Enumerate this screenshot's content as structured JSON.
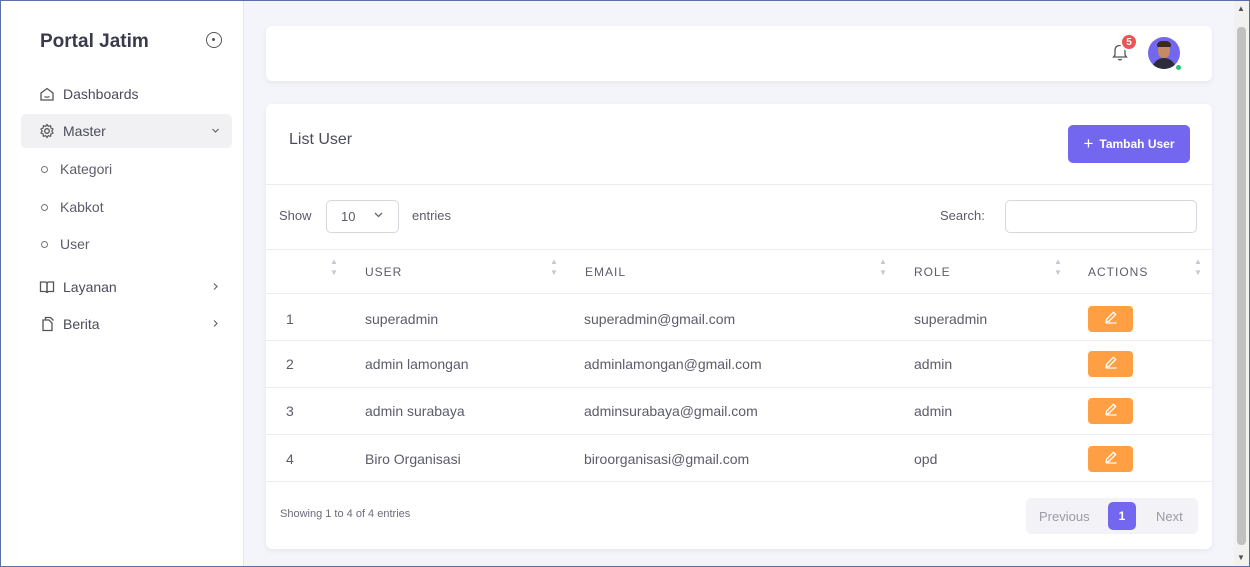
{
  "sidebar": {
    "brand": "Portal Jatim",
    "items": [
      {
        "label": "Dashboards",
        "icon": "home-icon"
      },
      {
        "label": "Master",
        "icon": "gear-icon",
        "chevron": "v"
      },
      {
        "label": "Layanan",
        "icon": "book-icon",
        "chevron": ">"
      },
      {
        "label": "Berita",
        "icon": "copy-icon",
        "chevron": ">"
      }
    ],
    "sub_items": [
      "Kategori",
      "Kabkot",
      "User"
    ]
  },
  "header": {
    "notification_count": "5",
    "avatar_status_color": "#28c76f"
  },
  "card": {
    "title": "List User",
    "add_button": "Tambah User",
    "show_label": "Show",
    "page_length": "10",
    "entries_label": "entries",
    "search_label": "Search:",
    "search_value": ""
  },
  "table": {
    "columns": [
      "USER",
      "EMAIL",
      "ROLE",
      "ACTIONS"
    ],
    "rows": [
      {
        "no": "1",
        "user": "superadmin",
        "email": "superadmin@gmail.com",
        "role": "superadmin"
      },
      {
        "no": "2",
        "user": "admin lamongan",
        "email": "adminlamongan@gmail.com",
        "role": "admin"
      },
      {
        "no": "3",
        "user": "admin surabaya",
        "email": "adminsurabaya@gmail.com",
        "role": "admin"
      },
      {
        "no": "4",
        "user": "Biro Organisasi",
        "email": "biroorganisasi@gmail.com",
        "role": "opd"
      }
    ]
  },
  "footer": {
    "info": "Showing 1 to 4 of 4 entries",
    "previous": "Previous",
    "current_page": "1",
    "next": "Next"
  },
  "colors": {
    "primary": "#7367f0",
    "warning": "#ff9f43",
    "danger": "#ea5455"
  }
}
